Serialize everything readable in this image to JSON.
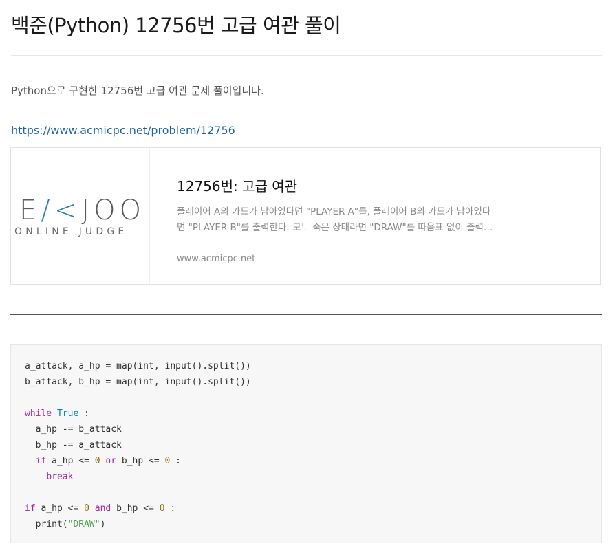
{
  "page": {
    "title": "백준(Python) 12756번 고급 여관 풀이",
    "intro": "Python으로 구현한 12756번 고급 여관 문제 풀이입니다.",
    "link": "https://www.acmicpc.net/problem/12756"
  },
  "card": {
    "logo_main_pre": "E",
    "logo_main_k": "/<",
    "logo_main_post": "JOO",
    "logo_sub": "ONLINE JUDGE",
    "title": "12756번: 고급 여관",
    "desc_line1": "플레이어 A의 카드가 남아있다면 \"PLAYER A\"를, 플레이어 B의 카드가 남아있다",
    "desc_line2": "면 \"PLAYER B\"를 출력한다. 모두 죽은 상태라면 \"DRAW\"를 따옴표 없이 출력…",
    "domain": "www.acmicpc.net"
  },
  "code": {
    "l1": "a_attack, a_hp = map(int, input().split())",
    "l2": "b_attack, b_hp = map(int, input().split())",
    "kw_while": "while",
    "kw_true": "True",
    "colon": " :",
    "l4": "a_hp -= b_attack",
    "l5": "b_hp -= a_attack",
    "kw_if": "if",
    "if_a": " a_hp <= ",
    "zero": "0",
    "kw_or": "or",
    "if_b": " b_hp <= ",
    "kw_break": "break",
    "kw_and": "and",
    "print_fn": "print(",
    "str_draw": "\"DRAW\"",
    "close_paren": ")"
  }
}
